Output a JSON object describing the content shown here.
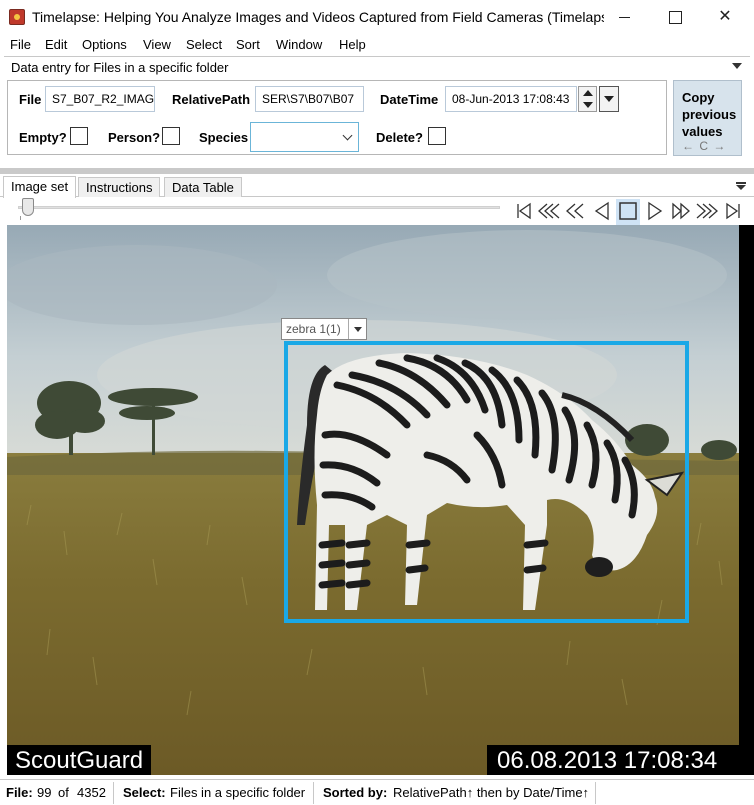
{
  "window": {
    "title": "Timelapse: Helping You Analyze Images and Videos Captured from Field Cameras (TimelapseDat..."
  },
  "menu": [
    "File",
    "Edit",
    "Options",
    "View",
    "Select",
    "Sort",
    "Window",
    "Help"
  ],
  "data_entry": {
    "header": "Data entry for Files in a specific folder",
    "file_label": "File",
    "file_value": "S7_B07_R2_IMAG",
    "relativepath_label": "RelativePath",
    "relativepath_value": "SER\\S7\\B07\\B07",
    "datetime_label": "DateTime",
    "datetime_value": "08-Jun-2013 17:08:43",
    "empty_label": "Empty?",
    "empty_checked": false,
    "person_label": "Person?",
    "person_checked": false,
    "species_label": "Species",
    "species_value": "",
    "delete_label": "Delete?",
    "delete_checked": false,
    "copy_button": {
      "label": "Copy previous values",
      "keys": "← C →"
    }
  },
  "tabs": [
    "Image set",
    "Instructions",
    "Data Table"
  ],
  "active_tab": "Image set",
  "navigation": {
    "buttons": [
      "first-image",
      "page-back-10",
      "page-back",
      "previous-image",
      "stop",
      "next-image",
      "page-forward",
      "page-forward-10",
      "last-image"
    ],
    "slider_position_fraction": 0.02
  },
  "image": {
    "bbox_label": "zebra 1(1)",
    "camera_brand": "ScoutGuard",
    "timestamp": "06.08.2013 17:08:34",
    "bbox_color": "#1aa8e6"
  },
  "status": {
    "file_label": "File:",
    "file_index": "99",
    "of_label": "of",
    "file_total": "4352",
    "select_label": "Select:",
    "select_value": "Files in a specific folder",
    "sorted_label": "Sorted by:",
    "sorted_value": "RelativePath↑ then by Date/Time↑"
  }
}
